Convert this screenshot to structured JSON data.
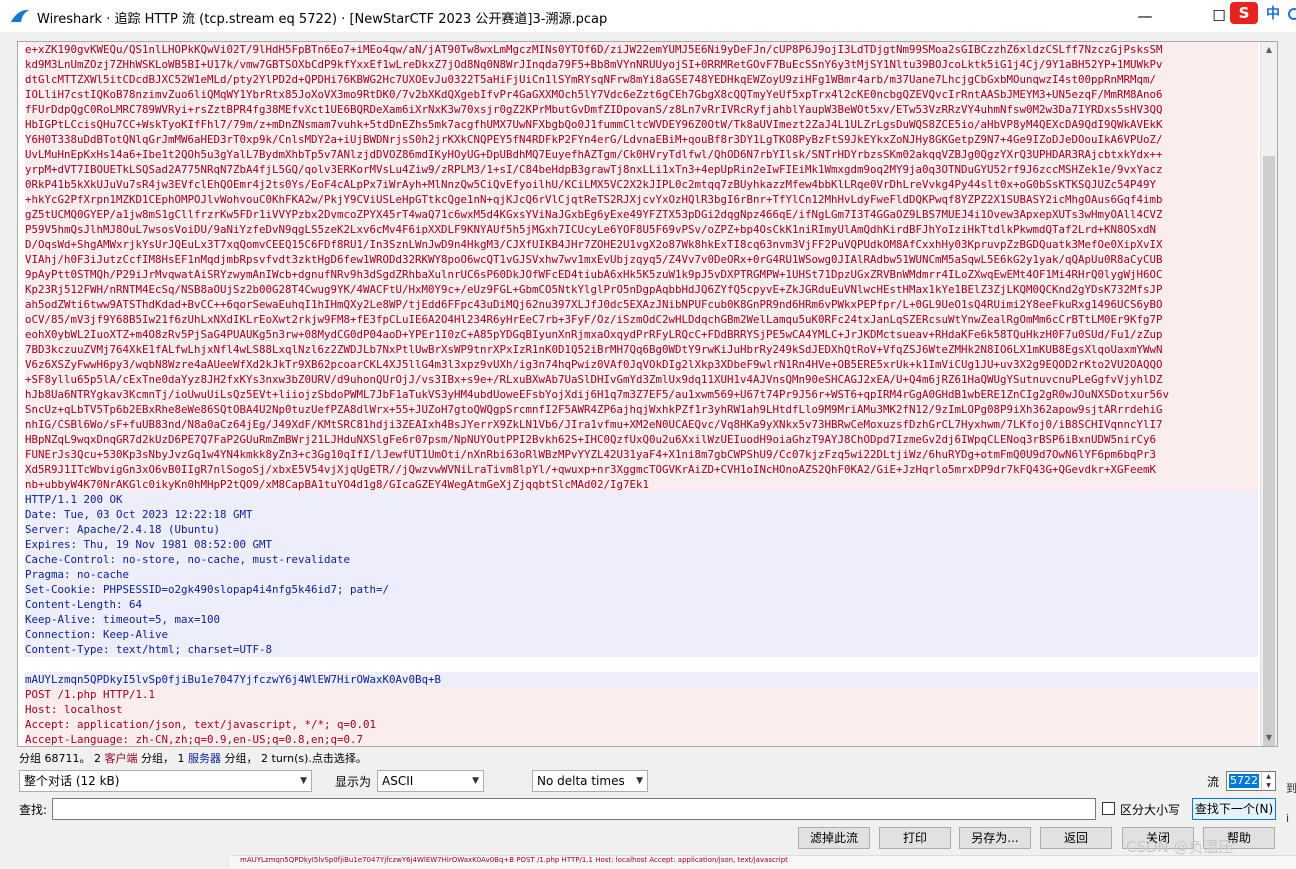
{
  "window": {
    "title": "Wireshark · 追踪 HTTP 流 (tcp.stream eq 5722) · [NewStarCTF 2023 公开赛道]3-溯源.pcap",
    "minimize": "—",
    "maximize": "☐",
    "close": "✕"
  },
  "ime": {
    "logo": "S",
    "mode": "中"
  },
  "stream": {
    "client_lines": [
      "e+xZK190gvKWEQu/QS1nlLHOPkKQwVi02T/9lHdH5FpBTn6Eo7+iMEo4qw/aN/jAT90Tw8wxLmMgczMINs0YTOf6D/ziJW22emYUMJ5E6Ni9yDeFJn/cUP8P6J9ojI3LdTDjgtNm99SMoa2sGIBCzzhZ6xldzCSLff7NzczGjPsksSM",
      "kd9M3LnUmZOzj7ZHhWSKLoWB5BI+U17k/vmw7GBTSOXbCdP9kfYxxEf1wLreDkxZ7jOd8Nq0N8WrJInqda79F5+Bb8mVYnNRUUyojSI+0RRMRetGOvF7BuEcSSnY6y3tMjSY1Nltu39BOJcoLktk5iG1j4Cj/9Y1aBH52YP+1MUWkPv",
      "dtGlcMTTZXWl5itCDcdBJXC52W1eMLd/pty2YlPD2d+QPDHi76KBWG2Hc7UXOEvJu0322T5aHiFjUiCn1lSYmRYsqNFrw8mYi8aGSE748YEDHkqEWZoyU9ziHFg1WBmr4arb/m37Uane7LhcjgCbGxbMOunqwzI4st00ppRnMRMqm/",
      "IOLliH7cstIQKoB78nzimvZuo6liQMqWY1YbrRtx85JoXoVX3mo9RtDK0/7v2bXKdQXgebIfvPr4GaGXXMOch5lY7Vdc6eZzt6gCEh7GbgX8cQQTmyYeUf5xpTrx4l2cKE0ncbgQZEVQvcIrRntAASbJMEYM3+UN5ezqF/MmRM8Ano6",
      "fFUrDdpQgC0RoLMRC789WVRyi+rsZztBPR4fg38MEfvXct1UE6BQRDeXam6iXrNxK3w70xsjr0gZ2KPrMbutGvDmfZIDpovanS/z8Ln7vRrIVRcRyfjahblYaupW3BeWOt5xv/ETw53VzRRzVY4uhmNfsw0M2w3Da7IYRDxs5sHV3QQ",
      "HbIGPtLCcisQHu7CC+WskTyoKIfFhl7/79m/z+mDnZNsmam7vuhk+5tdDnEZhs5mk7acgfhUMX7UwNFXbgbQo0J1fummCltcWVDEY96Z0OtW/Tk8aUVImezt2ZaJ4L1ULZrLgsDuWQS8ZCE5io/aHbVP8yM4QEXcDA9QdI9QWkAVEkK",
      "Y6H0T338uDdBTotQNlqGrJmMW6aHED3rT0xp9k/CnlsMDY2a+iUjBWDNrjsS0h2jrKXkCNQPEY5fN4RDFkP2FYn4erG/LdvnaEBiM+qouBf8r3DY1LgTKO8PyBzFtS9JkEYkxZoNJHy8GKGetpZ9N7+4Ge9IZoDJeDOouIkA6VPUoZ/",
      "UvLMuHnEpKxHs14a6+Ibe1t2QOh5u3gYalL7BydmXhbTp5v7ANlzjdDVOZ86mdIKyHOyUG+DpUBdhMQ7EuyefhAZTgm/Ck0HVryTdlfwl/QhOD6N7rbYIlsk/SNTrHDYrbzsSKm02akqqVZBJg0QgzYXrQ3UPHDAR3RAjcbtxkYdx++",
      "yrpM+dVT7IBOUETkLSQSad2A775NRqN7ZbA4fjL5GQ/qolv3ERKorMVsLu4Ziw9/zRPLM3/1+sI/C84beHdpB3grawTj8nxLLi1xTn3+4epUpRin2eIwFIEiMk1Wmxgdm9oq2MY9ja0q3OTNDuGYU52rf9J6zccMSHZek1e/9vxYacz",
      "0RkP41b5kXkUJuVu7sR4jw3EVfclEhQOEmr4j2ts0Ys/EoF4cALpPx7iWrAyh+MlNnzQw5CiQvEfyoilhU/KCiLMX5VC2X2kJIPL0c2mtqq7zBUyhkazzMfew4bbKlLRqe0VrDhLreVvkg4Py44slt0x+oG0bSsKTKSQJUZc54P49Y",
      "+hkYcG2PfXrpn1MZKD1CEphOMPOJlvWohvouC0KhFKA2w/PkjY9CViUSLeHpGTtkcQge1nN+qjKJcQ6rVlCjqtReTS2RJXjcvYxOzHQlR3bgI6rBnr+TfYlCn12MhHvLdyFweFldDQKPwqf8YZPZ2X1SUBASY2icMhgOAus6Gqf4imb",
      "gZ5tUCMQ0GYEP/a1jw8mS1gCllfrzrKw5FDr1iVVYPzbx2DvmcoZPYX45rT4waQ71c6wxM5d4KGxsYViNaJGxbEg6yExe49YFZTX53pDGi2dqgNpz466qE/ifNgLGm7I3T4GGaOZ9LBS7MUEJ4i1Ovew3ApxepXUTs3wHmyOAll4CVZ",
      "P59V5hmQsJlhMJ8OuL7wsosVoiDU/9aNiYzfeDvN9qgLS5zeK2Lxv6cMv4F6ipXXDLF9KNYAUf5h5jMGxh7ICUcyLe6YOF8U5F69vPSv/oZPZ+bp4OsCkK1niRImyUlAmQdhKirdBFJhYoIziHkTtdlkPkwmdQTaf2Lrd+KN8OSxdN",
      "D/OqsWd+ShgAMWxrjkYsUrJQEuLx3T7xqQomvCEEQ15C6FDf8RU1/In3SznLWnJwD9n4HkgM3/CJXfUIKB4JHr7ZOHE2U1vgX2o87Wk8hkExTI8cq63nvm3VjFF2PuVQPUdkOM8AfCxxhHy03KpruvpZzBGDQuatk3MefOe0XipXvIX",
      "VIAhj/h0F3iJutzCcfIM8HsEF1nMqdjmbRpsvfvdt3zktHgD6few1WRODd32RKWY8poO6wcQT1vGJSVxhw7wv1mxEvUbjzqyq5/Z4Vv7v0DeORx+0rG4RU1WSowg0JIAlRAdbw51WUNCmM5aSqwL5E6kG2y1yak/qQApUu0R8aCyCUB",
      "9pAyPtt0STMQh/P29iJrMvqwatAiSRYzwymAnIWcb+dgnufNRv9h3dSgdZRhbaXulnrUC6sP60DkJOfWFcED4tiubA6xHk5K5zuW1k9pJ5vDXPTRGMPW+1UHSt71DpzUGxZRVBnWMdmrr4ILoZXwqEwEMt4OF1Mi4RHrQ0lygWjH6OC",
      "Kp23Rj512FWH/nRNTM4EcSq/NSB8aOUjSz2b00G28T4Cwug9YK/4WACFtU/HxM0Y9c+/eUz9FGL+GbmCO5NtkYlglPrO5nDgpAqbbHdJQ6ZYfQ5cpyvE+ZkJGRduEuVNlwcHEstHMax1kYe1BElZ3ZjLKQM0QCKnd2gYDsK732MfsJP",
      "ah5odZWti6tww9ATSThdKdad+BvCC++6qorSewaEuhqI1hIHmQXy2Le8WP/tjEdd6FFpc43uDiMQj62nu397XLJfJ0dc5EXAzJNibNPUFcub0K8GnPR9nd6HRm6vPWkxPEPfpr/L+0GL9UeO1sQ4RUimi2Y8eeFkuRxg1496UCS6yBO",
      "oCV/85/mV3jf9Y68B5Iw21f6zUhLxNXdIKLrEoXwt2rkjw9FM8+fE3fpCLuIE6A2O4Hl234R6yHrEeC7rb+3FyF/Oz/iSzmOdC2wHLDdqchGBm2WelLamqu5uK0RFc24txJanLqSZERcsuWtYnwZealRgOmMm6cCrBTtLM0Er9Kfg7P",
      "eohX0ybWL2IuoXTZ+m4O8zRv5PjSaG4PUAUKg5n3rw+08MydCG0dP04aoD+YPEr1I0zC+A85pYDGqBIyunXnRjmxaOxqydPrRFyLRQcC+FDdBRRYSjPE5wCA4YMLC+JrJKDMctsueav+RHdaKFe6k58TQuHkzH0F7u0SUd/Fu1/zZup",
      "7BD3kczuuZVMj764XkE1fALfwLhjxNfl4wLS88LxqlNzl6z2ZWDJLb7NxPtlUwBrXsWP9tnrXPxIzR1nK0D1Q52iBrMH7Qq6Bg0WDtY9rwKiJuHbrRy249kSdJEDXhQtRoV+VfqZSJ6WteZMHk2N8IO6LX1mKUB8EgsXlqoUaxmYWwN",
      "V6z6XSZyFwwH6py3/wqbN8Wzre4aAUeeWfXd2kJkTr9XB62pcoarCKL4XJ5llG4m3l3xpz9vUXh/ig3n74hqPwiz0VAf0JqVOkDIg2lXkp3XDbeF9wlrN1Rn4HVe+OB5ERE5xrUk+k1ImViCUg1JU+uv3X2g9EQOD2rKto2VU2OAQQO",
      "+SF8yllu65p5lA/cExTne0daYyz8JH2fxKYs3nxw3bZ0URV/d9uhonQUrOjJ/vs3IBx+s9e+/RLxuBXwAb7UaSlDHIvGmYd3ZmlUx9dq11XUH1v4AJVnsQMn90eSHCAGJ2xEA/U+Q4m6jRZ61HaQWUgYSutnuvcnuPLeGgfvVjyhlDZ",
      "hJb8Ua6NTRYgkav3KcmnTj/ioUwuUiLsQz5EVt+liiojzSbdoPWML7JbF1aTukVS3yHM4ubdUoweEFsbYojXdij6H1q7m3Z7EF5/au1xwm569+U67t74Pr9J56r+WST6+qpIRM4rGgA0GHdB1wbERE1ZnCIg2gR0wJOuNXSDotxur56v",
      "SncUz+qLbTV5Tp6b2EBxRhe8eWe86SQtOBA4U2Np0tuzUefPZA8dlWrx+55+JUZoH7gtoQWQgpSrcmnfI2F5AWR4ZP6ajhqjWxhkPZf1r3yhRW1ah9LHtdfLlo9M9MriAMu3MK2fN12/9zImLOPg08P9iXh362apow9sjtARrrdehiG",
      "nhIG/CSBl6Wo/sF+fuUB83nd/N8a0aCz64jEg/J49XdF/KMtSRC81hdji3ZEAIxh4BsJYerrX9ZkLN1Vb6/JIra1vfmu+XM2eN0UCAEQvc/Vq8HKa9yXNkx5v73HBRwCeMoxuzsfDzhGrCL7Hyxhwm/7LKfoj0/iB8SCHIVqnncYlI7",
      "HBpNZqL9wqxDnqGR7d2kUzD6PE7Q7FaP2GUuRmZmBWrj21LJHduNXSlgFe6r07psm/NpNUYOutPPI2Bvkh62S+IHC0QzfUxQ0u2u6XxilWzUEIuodH9oiaGhzT9AYJ8ChODpd7IzmeGv2dj6IWpqCLENoq3rBSP6iBxnUDW5nirCy6",
      "FUNErJs3Qcu+530Kp3sNbyJvzGq1w4YN4kmkk8yZn3+c3Gg10qIfI/lJewfUT1UmOti/nXnRbi63oRlWBzMPvYYZL42U31yaF4+X1ni8m7gbCWPShU9/Cc07kjzFzq5wi22DLtjiWz/6huRYDg+otmFmQ0U9d7OwN6lYF6pm6bqPr3",
      "Xd5R9J1ITcWbvigGn3xO6vB0IIgR7nlSogoSj/xbxE5V54vjXjqUgETR//jQwzvwWVNiLraTivm8lpYl/+qwuxp+nr3XggmcTOGVKrAiZD+CVH1oINcHOnoAZS2QhF0KA2/GiE+JzHqrlo5mrxDP9dr7kFQ43G+QGevdkr+XGFeemK",
      "nb+ubbyW4K70NrAKGlc0ikyKn0hMHpP2tQO9/xM8CapBA1tuYO4d1g8/GIcaGZEY4WegAtmGeXjZjqqbtSlcMAd02/Ig7Ek1"
    ],
    "server_lines": [
      "HTTP/1.1 200 OK",
      "Date: Tue, 03 Oct 2023 12:22:18 GMT",
      "Server: Apache/2.4.18 (Ubuntu)",
      "Expires: Thu, 19 Nov 1981 08:52:00 GMT",
      "Cache-Control: no-store, no-cache, must-revalidate",
      "Pragma: no-cache",
      "Set-Cookie: PHPSESSID=o2gk490slopap4i4nfg5k46id7; path=/",
      "Content-Length: 64",
      "Keep-Alive: timeout=5, max=100",
      "Connection: Keep-Alive",
      "Content-Type: text/html; charset=UTF-8",
      "",
      "mAUYLzmqn5QPDkyI5lvSp0fjiBu1e7047YjfczwY6j4WlEW7HirOWaxK0Av0Bq+B"
    ],
    "client_lines_2": [
      "POST /1.php HTTP/1.1",
      "Host: localhost",
      "Accept: application/json, text/javascript, */*; q=0.01",
      "Accept-Language: zh-CN,zh;q=0.9,en-US;q=0.8,en;q=0.7"
    ]
  },
  "status": {
    "prefix": "分组 68711。",
    "n1": "2",
    "client_label": "客户端",
    "mid1": "分组，",
    "n2": "1",
    "server_label": "服务器",
    "mid2": "分组，",
    "n3": "2",
    "suffix": "turn(s).点击选择。"
  },
  "controls": {
    "conversation": "整个对话 (12 kB)",
    "show_as_label": "显示为",
    "show_as_value": "ASCII",
    "delta": "No delta times",
    "stream_label": "流",
    "stream_value": "5722",
    "find_label": "查找:",
    "find_value": "",
    "case_label": "区分大小写",
    "find_next": "查找下一个(N)"
  },
  "buttons": {
    "filter_out": "滤掉此流",
    "print": "打印",
    "save_as": "另存为...",
    "back": "返回",
    "close": "关闭",
    "help": "帮助"
  },
  "strip_text": "mAUYLzmqn5QPDkyI5lvSp0fjiBu1e7047YjfczwY6j4WlEW7HirOWaxK0Av0Bq+B  POST /1.php HTTP/1.1  Host: localhost  Accept: application/json, text/javascript",
  "watermark": "CSDN @负温压",
  "edge_chars": [
    "到",
    "i",
    "f",
    "n",
    "l",
    "r"
  ],
  "colors": {
    "client_fg": "#a0001f",
    "client_bg": "#fbeded",
    "server_fg": "#0a1e94",
    "server_bg": "#ededfb",
    "accent": "#0078d7"
  }
}
